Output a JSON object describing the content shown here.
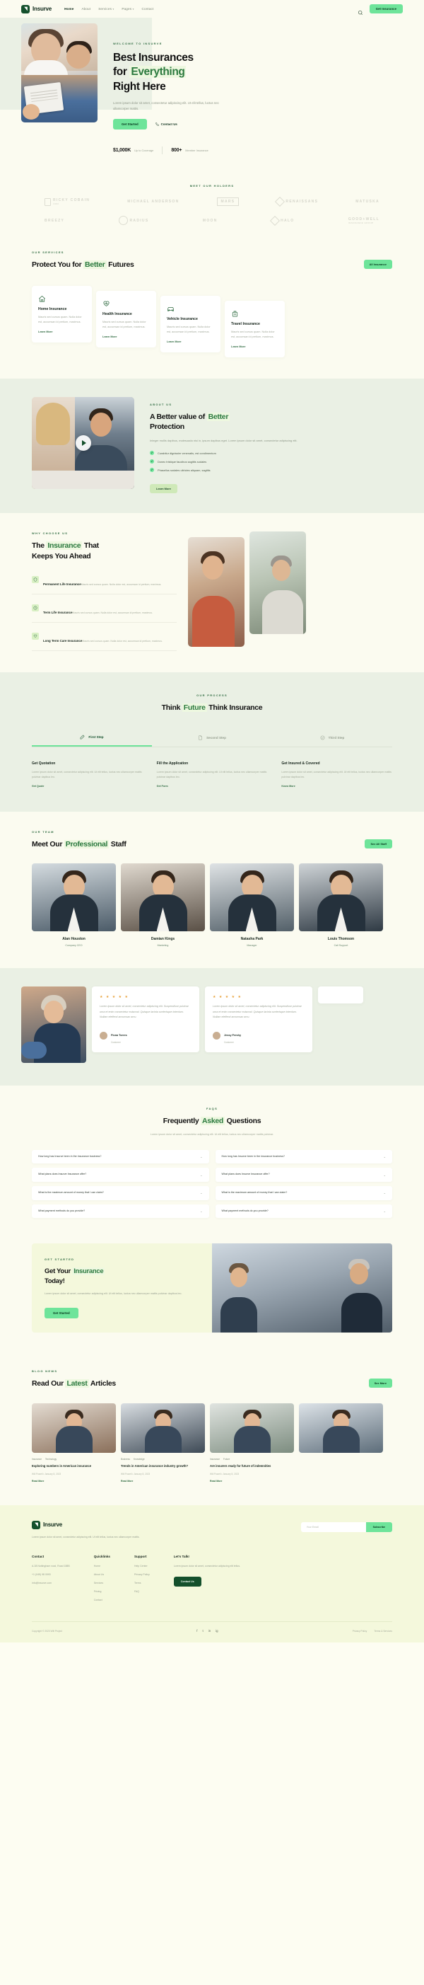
{
  "brand": {
    "name": "Insurve"
  },
  "header": {
    "nav": [
      {
        "label": "Home",
        "active": true,
        "caret": false
      },
      {
        "label": "About",
        "active": false,
        "caret": false
      },
      {
        "label": "Services",
        "active": false,
        "caret": true
      },
      {
        "label": "Pages",
        "active": false,
        "caret": true
      },
      {
        "label": "Contact",
        "active": false,
        "caret": false
      }
    ],
    "cta": "Get Insurance"
  },
  "hero": {
    "eyebrow": "WELCOME TO INSURVE",
    "title_line1": "Best Insurances",
    "title_line2_pre": "for ",
    "title_line2_hl": "Everything",
    "title_line3": "Right Here",
    "subtitle": "Lorem ipsum dolor sit amet, consectetur adipiscing elit. Ut elit tellus, luctus nec ullamcorper mattis.",
    "primary_btn": "Get Started",
    "secondary_btn": "Contact Us",
    "stats": [
      {
        "value": "$1,000K",
        "label": "Up to Coverage"
      },
      {
        "value": "800+",
        "label": "Member Insurance"
      }
    ]
  },
  "holders": {
    "eyebrow": "MEET OUR HOLDERS",
    "row1": [
      "RICKY COBAIN",
      "MICHAEL ANDERSON",
      "MARS",
      "RENAISSANS",
      "MATUSKA"
    ],
    "row1_sub": "1992",
    "row2": [
      "BREEZY",
      "RADIUS",
      "MOON",
      "HALO",
      "GOOD+WELL"
    ],
    "row2_sub": "INSURANCE GROUP"
  },
  "services": {
    "eyebrow": "OUR SERVICES",
    "title_pre": "Protect You for ",
    "title_hl": "Better",
    "title_post": " Futures",
    "btn": "All Insurance",
    "cards": [
      {
        "icon": "home-icon",
        "name": "Home Insurance",
        "desc": "Mauris sed cursus quam. Nulla dolor est, accumsan id pretium, maximus.",
        "link": "Learn More"
      },
      {
        "icon": "heart-pulse-icon",
        "name": "Health Insurance",
        "desc": "Mauris sed cursus quam. Nulla dolor est, accumsan id pretium, maximus.",
        "link": "Learn More"
      },
      {
        "icon": "car-icon",
        "name": "Vehicle Insurance",
        "desc": "Mauris sed cursus quam. Nulla dolor est, accumsan id pretium, maximus.",
        "link": "Learn More"
      },
      {
        "icon": "luggage-icon",
        "name": "Travel Insurance",
        "desc": "Mauris sed cursus quam. Nulla dolor est, accumsan id pretium, maximus.",
        "link": "Learn More"
      }
    ]
  },
  "about": {
    "eyebrow": "ABOUT US",
    "title_pre": "A Better value of ",
    "title_hl": "Better",
    "title_post": "Protection",
    "desc": "Integer mollis dapibus, malesuada nisi in, ipsum dapibus eget. Lorem ipsum dolor sit amet, consectetur adipiscing elit.",
    "checks": [
      "Curabitur dignissim venenatis, est condimentum",
      "Donec tristique faucibus sagittis sodales",
      "Phasellus sodales ultricies aliquam, sagittis"
    ],
    "btn": "Learn More"
  },
  "why": {
    "eyebrow": "WHY CHOOSE US",
    "title_pre": "The ",
    "title_hl": "Insurance",
    "title_post": " That",
    "title_line2": "Keeps You Ahead",
    "items": [
      {
        "icon": "shield-icon",
        "title": "Permanent Life Insurance",
        "desc": "Mauris sed cursus quam. Nulla dolor est, accumsan id pretium, maximus."
      },
      {
        "icon": "clock-icon",
        "title": "Term Life Insurance",
        "desc": "Mauris sed cursus quam. Nulla dolor est, accumsan id pretium, maximus."
      },
      {
        "icon": "heart-icon",
        "title": "Long Term Care Insurance",
        "desc": "Mauris sed cursus quam. Nulla dolor est, accumsan id pretium, maximus."
      }
    ]
  },
  "process": {
    "eyebrow": "OUR PROCESS",
    "title_pre": "Think ",
    "title_hl": "Future",
    "title_post": " Think Insurance",
    "tabs": [
      {
        "label": "First Step",
        "icon": "pen-icon",
        "active": true
      },
      {
        "label": "Second Step",
        "icon": "file-icon",
        "active": false
      },
      {
        "label": "Third Step",
        "icon": "check-icon",
        "active": false
      }
    ],
    "columns": [
      {
        "title": "Get Quotation",
        "desc": "Lorem ipsum dolor sit amet, consectetur adipiscing elit. Ut elit tellus, luctus nec ullamcorper mattis pulvinar dapibus leo.",
        "link": "Get Quote"
      },
      {
        "title": "Fill the Application",
        "desc": "Lorem ipsum dolor sit amet, consectetur adipiscing elit. Ut elit tellus, luctus nec ullamcorper mattis pulvinar dapibus leo.",
        "link": "Get Form"
      },
      {
        "title": "Get Insured & Covered",
        "desc": "Lorem ipsum dolor sit amet, consectetur adipiscing elit. Ut elit tellus, luctus nec ullamcorper mattis pulvinar dapibus leo.",
        "link": "Know More"
      }
    ]
  },
  "team": {
    "eyebrow": "OUR TEAM",
    "title_pre": "Meet Our ",
    "title_hl": "Professional",
    "title_post": " Staff",
    "btn": "See All Staff",
    "members": [
      {
        "name": "Alan Houston",
        "role": "Company CEO"
      },
      {
        "name": "Damian Kings",
        "role": "Marketing"
      },
      {
        "name": "Natasha Park",
        "role": "Manager"
      },
      {
        "name": "Louis Thomson",
        "role": "Call Support"
      }
    ]
  },
  "testimonials": [
    {
      "stars": "★ ★ ★ ★ ★",
      "quote": "Lorem ipsum dolor sit amet, consectetur adipiscing elit. Suspendisse pulvinar urna et enim consectetur euismod. Quisque lacinia scelerisque interdum. Nullam eleifend accumsan arcu.",
      "name": "Fiona Torres",
      "role": "Customer"
    },
    {
      "stars": "★ ★ ★ ★ ★",
      "quote": "Lorem ipsum dolor sit amet, consectetur adipiscing elit. Suspendisse pulvinar urna et enim consectetur euismod. Quisque lacinia scelerisque interdum. Nullam eleifend accumsan arcu.",
      "name": "Jessy Freshy",
      "role": "Customer"
    }
  ],
  "faq": {
    "eyebrow": "FAQS",
    "title_pre": "Frequently ",
    "title_hl": "Asked",
    "title_post": " Questions",
    "sub": "Lorem ipsum dolor sit amet, consectetur adipiscing elit. Ut elit tellus, luctus nec ullamcorper mattis pulvinar.",
    "items": [
      "How long has Insurve been in the insurance business?",
      "How long has Insurve been in the insurance business?",
      "What plans does Insurve Insurance offer?",
      "What plans does Insurve Insurance offer?",
      "What is the maximum amount of money that I can claim?",
      "What is the maximum amount of money that I can claim?",
      "What payment methods do you provide?",
      "What payment methods do you provide?"
    ]
  },
  "cta": {
    "eyebrow": "GET STARTED",
    "title_pre": "Get Your ",
    "title_hl": "Insurance",
    "title_post": "Today!",
    "desc": "Lorem ipsum dolor sit amet, consectetur adipiscing elit. Ut elit tellus, luctus nec ullamcorper mattis pulvinar dapibus leo.",
    "btn": "Get Started"
  },
  "news": {
    "eyebrow": "BLOG NEWS",
    "title_pre": "Read Our ",
    "title_hl": "Latest",
    "title_post": " Articles",
    "btn": "See More",
    "articles": [
      {
        "tags": [
          "Insurance",
          "Technology"
        ],
        "title": "Exploring numbers in American insurance",
        "meta": "Will Powell  •  January 8, 2023",
        "link": "Read More"
      },
      {
        "tags": [
          "Business",
          "Knowledge"
        ],
        "title": "Trends in American insurance industry growth?",
        "meta": "Will Powell  •  January 8, 2023",
        "link": "Read More"
      },
      {
        "tags": [
          "Insurance",
          "Future"
        ],
        "title": "Are insurers ready for future of indemnities",
        "meta": "Will Powell  •  January 8, 2023",
        "link": "Read More"
      }
    ]
  },
  "footer": {
    "tagline": "Lorem ipsum dolor sit amet, consectetur adipiscing elit. Ut elit tellus, luctus nec ullamcorper mattis.",
    "email_placeholder": "Your Email",
    "subscribe": "Subscribe",
    "cols": [
      {
        "head": "Contact",
        "items": [
          "A-38 Nottingham road, Road 188B",
          "+1 (045) 98 0993",
          "info@insurve.com"
        ]
      },
      {
        "head": "Quicklinks",
        "items": [
          "Home",
          "About Us",
          "Services",
          "Pricing",
          "Contact"
        ]
      },
      {
        "head": "Support",
        "items": [
          "Help Center",
          "Privacy Policy",
          "Terms",
          "FAQ"
        ]
      }
    ],
    "talk": {
      "head": "Let's Talk!",
      "desc": "Lorem ipsum dolor sit amet, consectetur adipiscing elit tellus.",
      "btn": "Contact Us"
    },
    "copyright": "Copyright © 2023 Will Project",
    "social": [
      "f",
      "t",
      "in",
      "ig"
    ],
    "legal": [
      "Privacy Policy",
      "Terms & Services"
    ]
  }
}
